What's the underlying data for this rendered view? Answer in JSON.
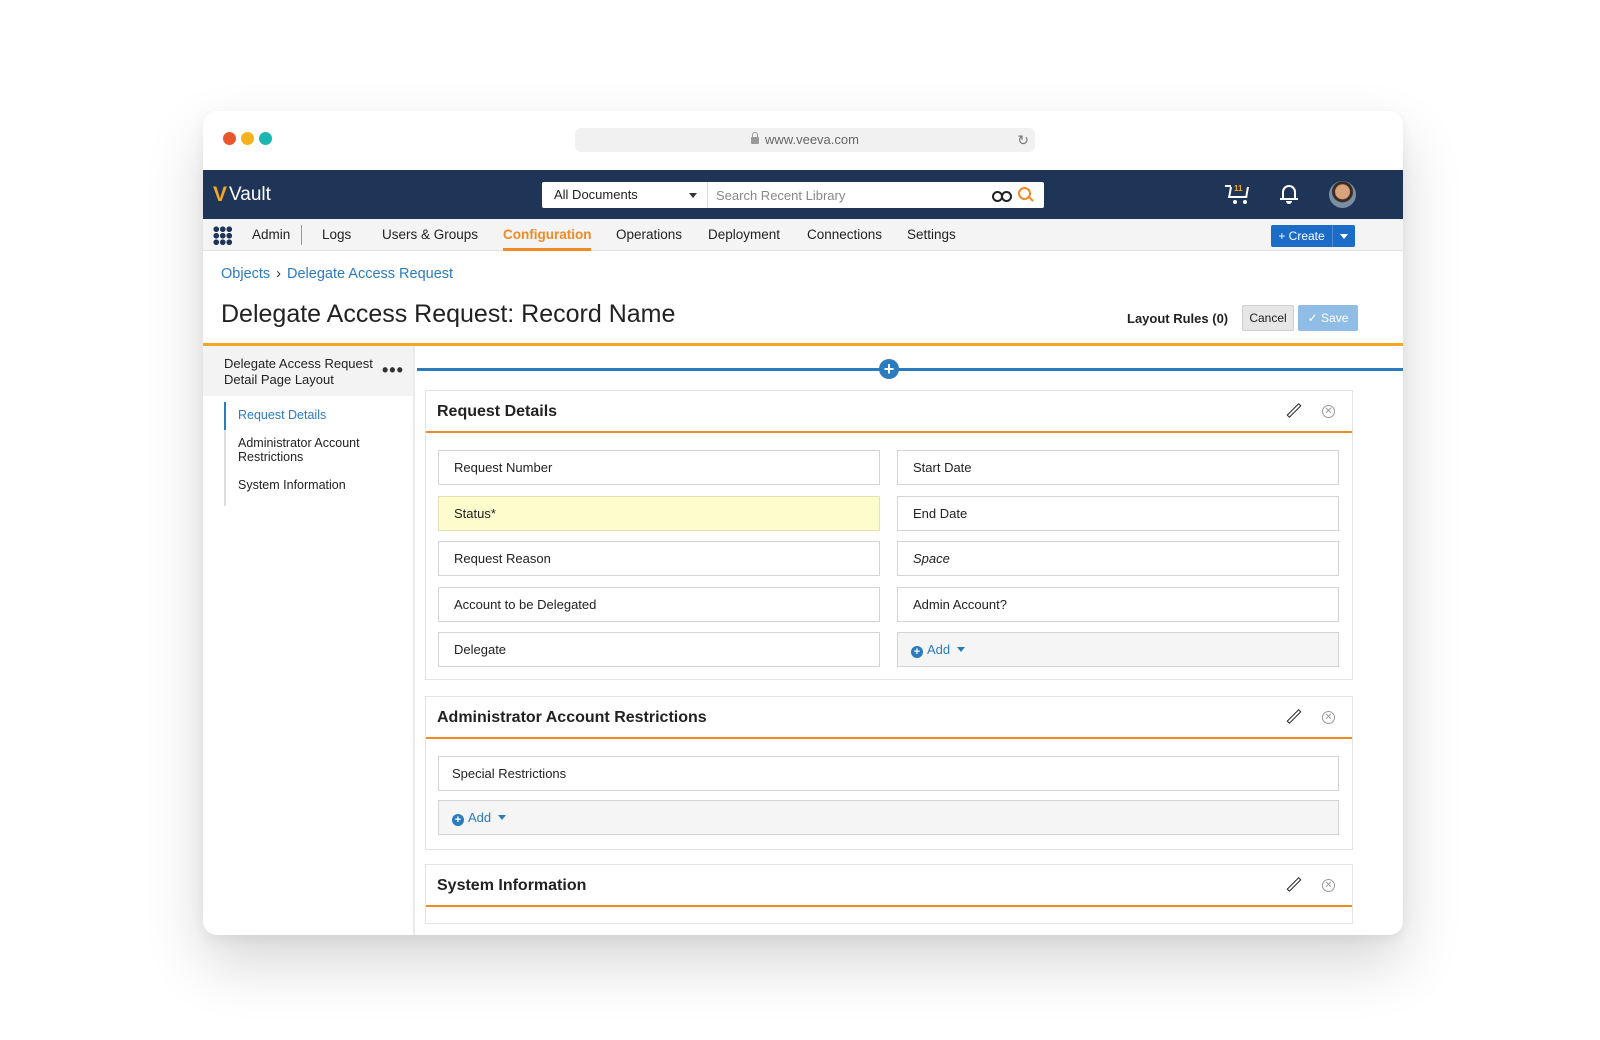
{
  "browser": {
    "url": "www.veeva.com",
    "dots": [
      "#e8572c",
      "#f5b21a",
      "#1ab8b0"
    ]
  },
  "topnav": {
    "app_name": "Vault",
    "scope_label": "All Documents",
    "search_placeholder": "Search Recent Library",
    "cart_count": "11",
    "icons": [
      "binoculars-icon",
      "search-icon",
      "cart-icon",
      "bell-icon",
      "avatar"
    ]
  },
  "subnav": {
    "tabs": [
      "Admin",
      "Logs",
      "Users & Groups",
      "Configuration",
      "Operations",
      "Deployment",
      "Connections",
      "Settings"
    ],
    "active_tab": "Configuration",
    "create_label": "+ Create"
  },
  "breadcrumb": {
    "root": "Objects",
    "separator": "›",
    "current": "Delegate Access Request"
  },
  "page": {
    "title": "Delegate Access Request: Record Name",
    "layout_rules": "Layout Rules (0)",
    "cancel_label": "Cancel",
    "save_label": "✓ Save"
  },
  "left_panel": {
    "header": "Delegate Access Request Detail Page Layout",
    "more": "•••",
    "items": [
      "Request Details",
      "Administrator Account Restrictions",
      "System Information"
    ],
    "active": "Request Details"
  },
  "sections": [
    {
      "title": "Request Details",
      "left_fields": [
        "Request Number",
        "Status*",
        "Request Reason",
        "Account to be Delegated",
        "Delegate"
      ],
      "right_fields": [
        "Start Date",
        "End Date",
        "Space",
        "Admin Account?"
      ],
      "add_label": "Add"
    },
    {
      "title": "Administrator Account Restrictions",
      "fields": [
        "Special Restrictions"
      ],
      "add_label": "Add"
    },
    {
      "title": "System Information"
    }
  ],
  "colors": {
    "nav": "#1e3557",
    "accent": "#f08a24",
    "link": "#2b7bbf",
    "required": "#fcfccd"
  }
}
